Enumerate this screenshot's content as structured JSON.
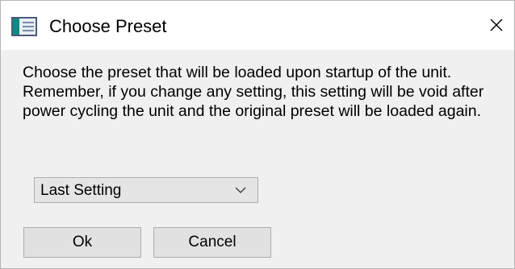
{
  "window": {
    "title": "Choose Preset",
    "icon": "app-window-icon",
    "close_icon": "close-icon"
  },
  "dialog": {
    "message": "Choose the preset that will be loaded upon startup of the unit. Remember, if you change any setting, this setting will be void after power cycling the unit and the original preset will be loaded again.",
    "preset_select": {
      "selected": "Last Setting",
      "icon": "chevron-down-icon"
    },
    "buttons": {
      "ok_label": "Ok",
      "cancel_label": "Cancel"
    }
  },
  "colors": {
    "titlebar_bg": "#ffffff",
    "client_bg": "#f0f0f0",
    "button_bg": "#e1e1e1",
    "button_border": "#adadad",
    "icon_accent": "#0f8a83"
  }
}
